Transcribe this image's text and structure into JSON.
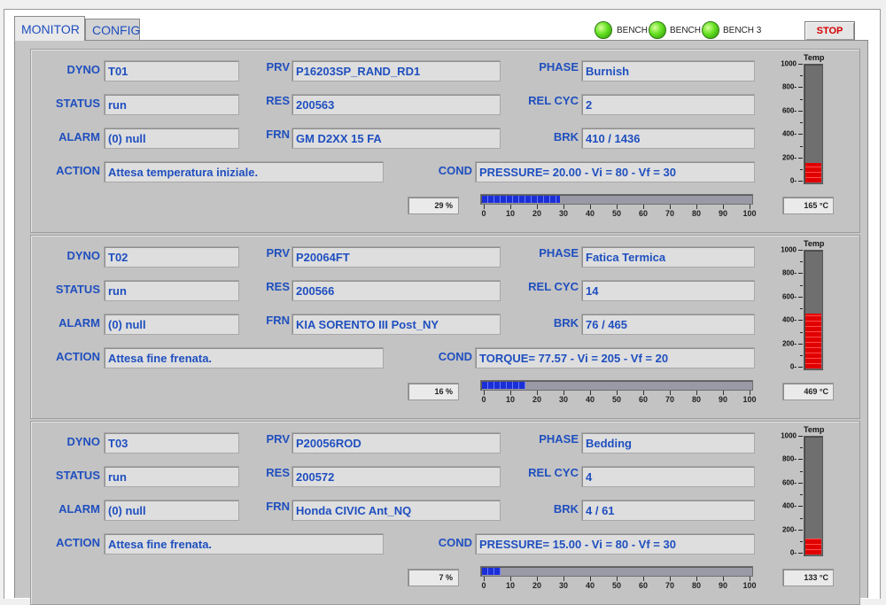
{
  "tabs": [
    {
      "label": "MONITOR",
      "active": true
    },
    {
      "label": "CONFIG",
      "active": false
    }
  ],
  "benches": [
    {
      "label": "BENCH 1",
      "status": "green"
    },
    {
      "label": "BENCH 2",
      "status": "green"
    },
    {
      "label": "BENCH 3",
      "status": "green"
    }
  ],
  "stop_label": "STOP",
  "field_labels": {
    "dyno": "DYNO",
    "status": "STATUS",
    "alarm": "ALARM",
    "action": "ACTION",
    "prv": "PRV",
    "res": "RES",
    "frn": "FRN",
    "cond": "COND",
    "phase": "PHASE",
    "rel_cyc": "REL CYC",
    "brk": "BRK",
    "temp": "Temp"
  },
  "progress_ticks": [
    "0",
    "10",
    "20",
    "30",
    "40",
    "50",
    "60",
    "70",
    "80",
    "90",
    "100"
  ],
  "temp_ticks": [
    "0-",
    "200-",
    "400-",
    "600-",
    "800-",
    "1000"
  ],
  "temp_max": 1000,
  "colors": {
    "label_blue": "#1f4fbf",
    "progress_blue": "#1b2fd6",
    "temp_red": "#e10000",
    "led_green": "#63e021",
    "stop_red": "#d40000"
  },
  "dynos": [
    {
      "dyno": "T01",
      "status": "run",
      "alarm": "(0) null",
      "action": "Attesa temperatura iniziale.",
      "prv": "P16203SP_RAND_RD1",
      "res": "200563",
      "frn": "GM D2XX 15 FA",
      "cond": "PRESSURE= 20.00 - Vi = 80 - Vf = 30",
      "phase": "Burnish",
      "rel_cyc": "2",
      "brk": "410 / 1436",
      "progress": 29,
      "progress_text": "29 %",
      "temp": 165,
      "temp_text": "165 °C"
    },
    {
      "dyno": "T02",
      "status": "run",
      "alarm": "(0) null",
      "action": "Attesa fine frenata.",
      "prv": "P20064FT",
      "res": "200566",
      "frn": "KIA SORENTO III Post_NY",
      "cond": "TORQUE= 77.57 - Vi = 205 - Vf = 20",
      "phase": "Fatica Termica",
      "rel_cyc": "14",
      "brk": "76 / 465",
      "progress": 16,
      "progress_text": "16 %",
      "temp": 469,
      "temp_text": "469 °C"
    },
    {
      "dyno": "T03",
      "status": "run",
      "alarm": "(0) null",
      "action": "Attesa fine frenata.",
      "prv": "P20056ROD",
      "res": "200572",
      "frn": "Honda CIVIC Ant_NQ",
      "cond": "PRESSURE= 15.00 - Vi = 80 - Vf = 30",
      "phase": "Bedding",
      "rel_cyc": "4",
      "brk": "4 / 61",
      "progress": 7,
      "progress_text": "7 %",
      "temp": 133,
      "temp_text": "133 °C"
    }
  ]
}
